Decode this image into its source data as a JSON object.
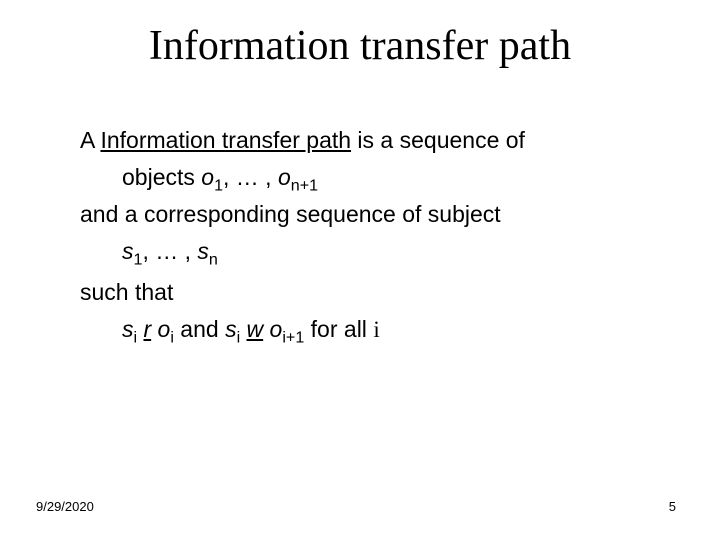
{
  "title": "Information transfer path",
  "para1_a": "A ",
  "para1_term": "Information transfer path",
  "para1_b": " is a sequence of",
  "para1_line2_a": "objects    ",
  "seq_o_lead": "o",
  "seq_o_sub1": "1",
  "seq_sep": ", … , ",
  "seq_o_lead2": "o",
  "seq_o_sub2": "n+1",
  "para2": "and a corresponding sequence of subject",
  "seq_s_lead": "s",
  "seq_s_sub1": "1",
  "seq_s_lead2": "s",
  "seq_s_sub2": "n",
  "para3": "such that",
  "m_s1": "s",
  "m_i1": "i",
  "m_sp1": " ",
  "m_r": "r",
  "m_sp2": " ",
  "m_o1": "o",
  "m_i2": "i",
  "m_and": "   and   ",
  "m_s2": "s",
  "m_i3": "i",
  "m_sp3": " ",
  "m_w": "w",
  "m_sp4": " ",
  "m_o2": "o",
  "m_i4": "i+1",
  "m_tail": "  for all ",
  "m_ivar": "i",
  "footer_date": "9/29/2020",
  "footer_page": "5"
}
